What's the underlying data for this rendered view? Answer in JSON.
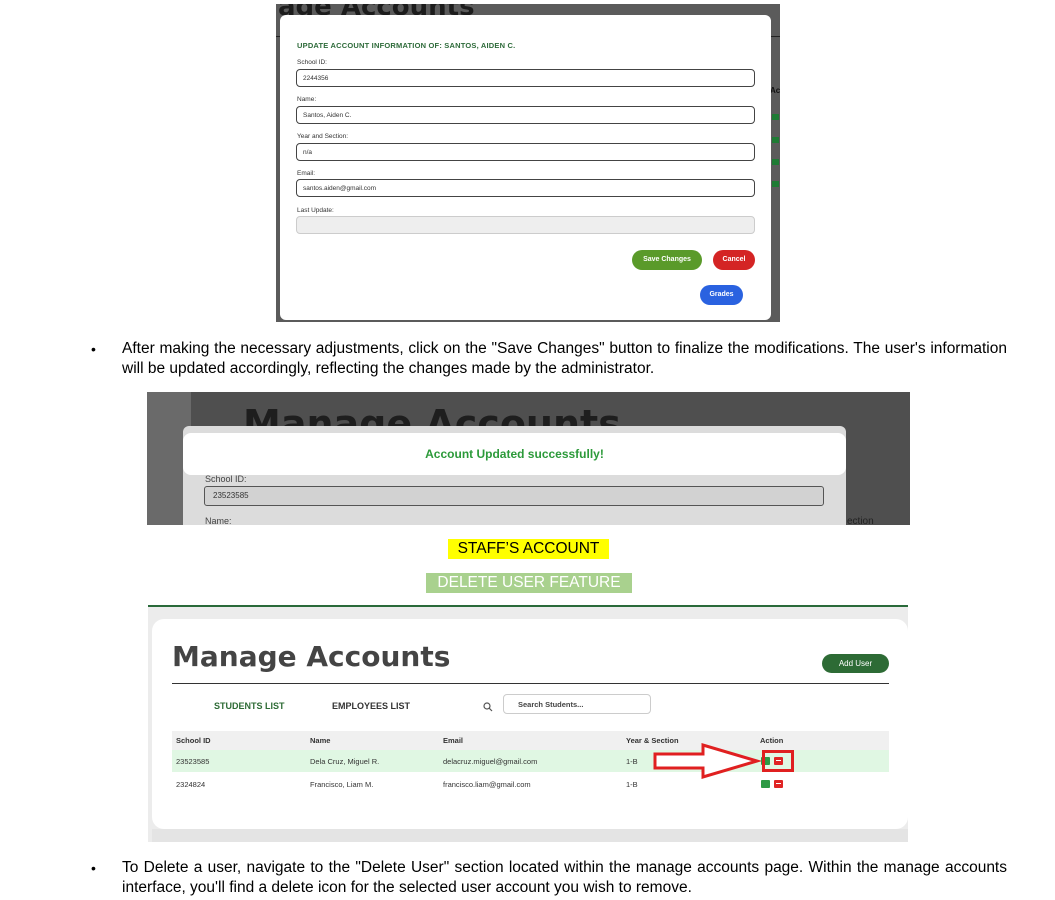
{
  "shot1": {
    "bg_title": "age Accounts",
    "bg_col_label": "Ac",
    "modal_title": "UPDATE ACCOUNT INFORMATION OF: SANTOS, AIDEN C.",
    "fields": [
      {
        "label": "School ID:",
        "value": "2244356"
      },
      {
        "label": "Name:",
        "value": "Santos, Aiden C."
      },
      {
        "label": "Year and Section:",
        "value": "n/a"
      },
      {
        "label": "Email:",
        "value": "santos.aiden@gmail.com"
      },
      {
        "label": "Last Update:",
        "value": ""
      }
    ],
    "save_label": "Save Changes",
    "cancel_label": "Cancel",
    "grades_label": "Grades",
    "colors": {
      "save": "#5a9a2a",
      "cancel": "#d42424",
      "grades": "#2a62e0",
      "title": "#2e6b3a"
    }
  },
  "para1": {
    "bullet": "•",
    "text": "After making the necessary adjustments, click on the \"Save Changes\" button to finalize the modifications. The user's information will be updated accordingly, reflecting the changes made by the administrator."
  },
  "shot2": {
    "bg_title": "Manage Accounts",
    "toast": "Account Updated successfully!",
    "school_id_label": "School ID:",
    "school_id_value": "23523585",
    "name_label": "Name:",
    "right_text": "ection",
    "toast_color": "#2c9a3a"
  },
  "headings": {
    "staff": "STAFF’S ACCOUNT",
    "delete": "DELETE USER FEATURE"
  },
  "shot3": {
    "title": "Manage Accounts",
    "add_user": "Add User",
    "tabs": {
      "students": "STUDENTS LIST",
      "employees": "EMPLOYEES LIST"
    },
    "search_placeholder": "Search Students...",
    "columns": [
      "School ID",
      "Name",
      "Email",
      "Year & Section",
      "Action"
    ],
    "rows": [
      {
        "id": "23523585",
        "name": "Dela Cruz, Miguel R.",
        "email": "delacruz.miguel@gmail.com",
        "section": "1-B"
      },
      {
        "id": "2324824",
        "name": "Francisco, Liam M.",
        "email": "francisco.liam@gmail.com",
        "section": "1-B"
      }
    ],
    "colors": {
      "accent": "#2d6b35",
      "highlight_row": "#e0f7e3",
      "edit": "#2e9a45",
      "delete": "#e02424"
    }
  },
  "para2": {
    "bullet": "•",
    "text": "To Delete a user, navigate to the \"Delete User\" section located within the manage accounts page. Within the manage accounts interface, you'll find a delete icon for the selected user account you wish to remove."
  }
}
